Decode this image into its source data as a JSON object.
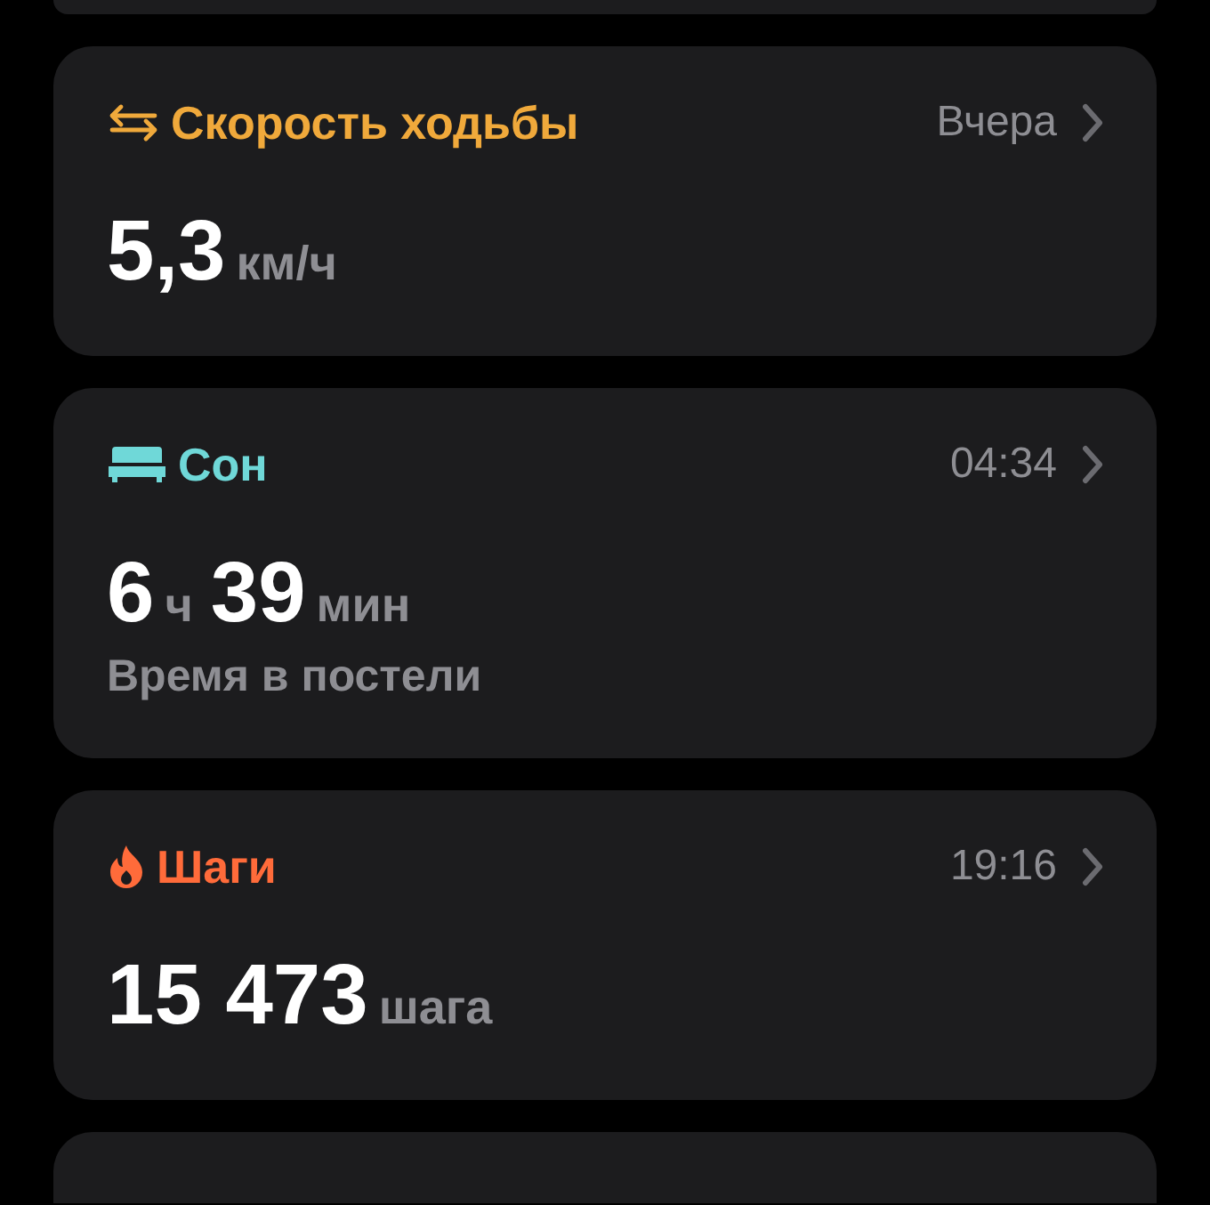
{
  "cards": [
    {
      "kind": "arrows",
      "color": "#f0a93b",
      "title": "Скорость ходьбы",
      "time": "Вчера",
      "value": [
        {
          "kind": "number",
          "text": "5,3"
        },
        {
          "kind": "unit",
          "text": "км/ч"
        }
      ]
    },
    {
      "kind": "bed",
      "color": "#6fd8d8",
      "title": "Сон",
      "time": "04:34",
      "value": [
        {
          "kind": "number",
          "text": "6"
        },
        {
          "kind": "unit",
          "text": "ч"
        },
        {
          "kind": "number",
          "text": "39"
        },
        {
          "kind": "unit",
          "text": "мин"
        }
      ],
      "subtitle": "Время в постели"
    },
    {
      "kind": "flame",
      "color": "#ff6b3a",
      "title": "Шаги",
      "time": "19:16",
      "value": [
        {
          "kind": "number",
          "text": "15 473"
        },
        {
          "kind": "unit",
          "text": "шага"
        }
      ]
    }
  ]
}
